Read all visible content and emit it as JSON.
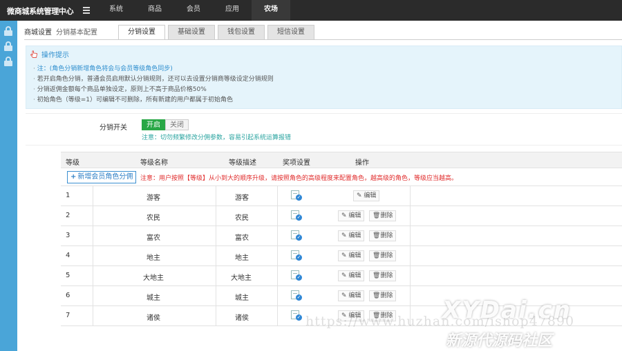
{
  "topbar": {
    "brand": "微商城系统管理中心",
    "nav": [
      "系统",
      "商品",
      "会员",
      "应用",
      "农场"
    ],
    "active_index": 4
  },
  "breadcrumb": {
    "section": "商城设置",
    "sub": "分销基本配置"
  },
  "tabs": [
    "分销设置",
    "基础设置",
    "钱包设置",
    "短信设置"
  ],
  "tips": {
    "title": "操作提示",
    "items": [
      "注：(角色分销新增角色将会与会员等级角色同步)",
      "若开启角色分销，普通会员启用默认分销规则，还可以去设置分销商等级设定分销规则",
      "分销返佣金额每个商品单独设定，原则上不高于商品价格50%",
      "初始角色（等级=1）可编辑不可删除，所有新建的用户都属于初始角色"
    ]
  },
  "switch": {
    "label": "分销开关",
    "on": "开启",
    "off": "关闭",
    "warning": "注意：切勿频繁修改分佣参数，容易引起系统运算报错"
  },
  "table": {
    "headers": {
      "level": "等级",
      "name": "等级名称",
      "desc": "等级描述",
      "prize": "奖项设置",
      "ops": "操作"
    },
    "add_button": "新增会员角色分佣",
    "add_warning": "注意：用户按照【等级】从小到大的顺序升级，请按照角色的高级程度来配置角色，越高级的角色，等级应当越高。",
    "edit_label": "编辑",
    "delete_label": "删除",
    "rows": [
      {
        "level": "1",
        "name": "游客",
        "desc": "游客",
        "deletable": false
      },
      {
        "level": "2",
        "name": "农民",
        "desc": "农民",
        "deletable": true
      },
      {
        "level": "3",
        "name": "富农",
        "desc": "富农",
        "deletable": true
      },
      {
        "level": "4",
        "name": "地主",
        "desc": "地主",
        "deletable": true
      },
      {
        "level": "5",
        "name": "大地主",
        "desc": "大地主",
        "deletable": true
      },
      {
        "level": "6",
        "name": "城主",
        "desc": "城主",
        "deletable": true
      },
      {
        "level": "7",
        "name": "诸侯",
        "desc": "诸侯",
        "deletable": true
      }
    ]
  },
  "watermark": {
    "url": "https://www.huzhan.com/ishop47890",
    "brand": "XYDai.cn",
    "brand_cn": "新源代源码社区"
  }
}
